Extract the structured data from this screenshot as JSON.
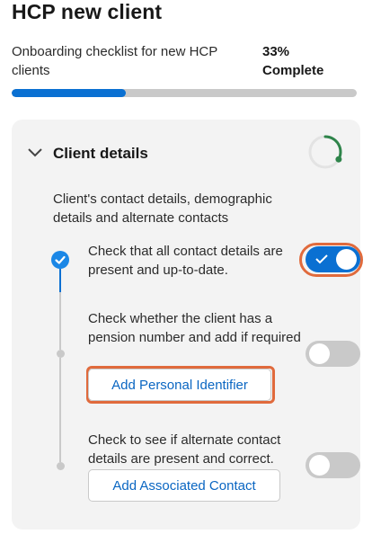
{
  "header": {
    "title": "HCP new client",
    "subtitle": "Onboarding checklist for new HCP clients",
    "percent_label": "33%",
    "complete_label": "Complete",
    "progress_fraction": 0.33
  },
  "section": {
    "title": "Client details",
    "description": "Client's contact details, demographic details and alternate contacts",
    "ring_fraction": 0.33
  },
  "steps": [
    {
      "text": "Check that all contact details are present and up-to-date.",
      "done": true,
      "toggle_on": true
    },
    {
      "text": "Check whether the client has a pension number and add if required",
      "done": false,
      "toggle_on": false,
      "button_label": "Add Personal Identifier"
    },
    {
      "text": "Check to see if alternate contact details are present and correct.",
      "done": false,
      "toggle_on": false,
      "button_label": "Add Associated Contact"
    }
  ],
  "colors": {
    "accent": "#0a70d2",
    "highlight": "#e06a3c",
    "ring": "#2e844a",
    "track": "#c9c9c9"
  }
}
